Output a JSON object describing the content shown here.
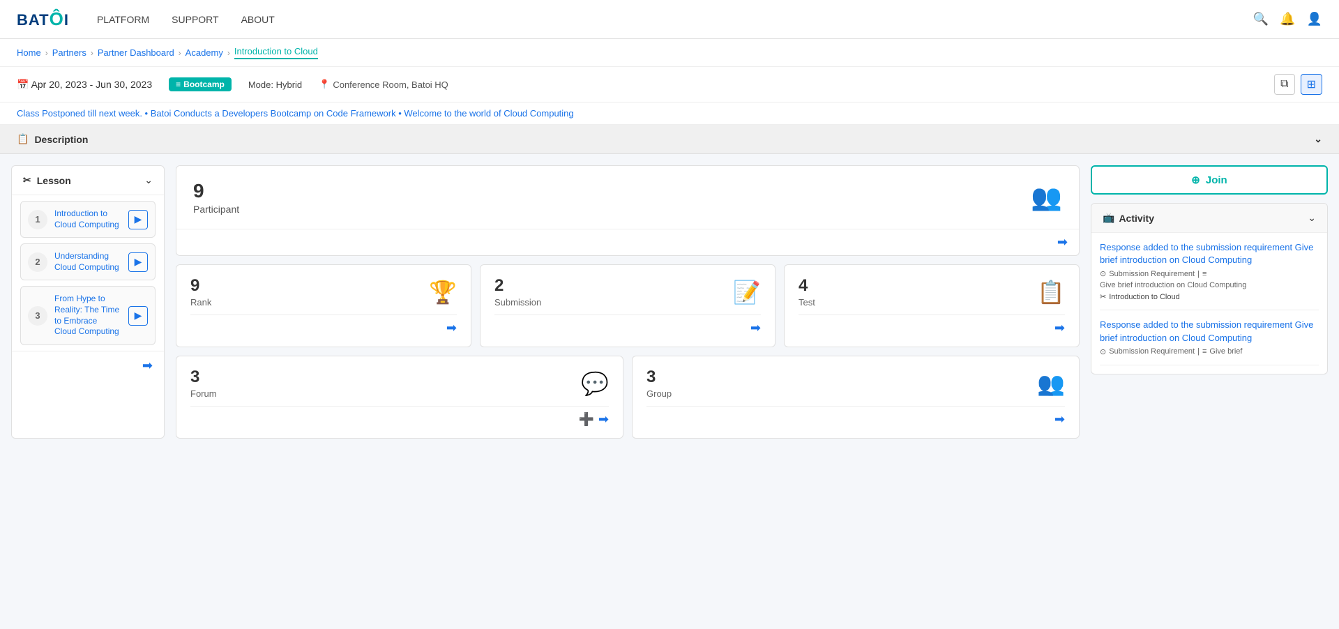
{
  "header": {
    "logo": "BATOI",
    "nav": [
      {
        "label": "PLATFORM",
        "id": "platform"
      },
      {
        "label": "SUPPORT",
        "id": "support"
      },
      {
        "label": "ABOUT",
        "id": "about"
      }
    ]
  },
  "breadcrumb": {
    "items": [
      "Home",
      "Partners",
      "Partner Dashboard",
      "Academy",
      "Introduction to Cloud"
    ]
  },
  "meta": {
    "date": "Apr 20, 2023  -  Jun 30, 2023",
    "badge": "Bootcamp",
    "mode": "Mode: Hybrid",
    "location": "Conference Room, Batoi HQ"
  },
  "ticker": "Class Postponed till next week.  •  Batoi Conducts a Developers Bootcamp on Code Framework  •  Welcome to the world of Cloud Computing",
  "description": {
    "label": "Description"
  },
  "lesson": {
    "title": "Lesson",
    "items": [
      {
        "num": 1,
        "title": "Introduction to Cloud Computing"
      },
      {
        "num": 2,
        "title": "Understanding Cloud Computing"
      },
      {
        "num": 3,
        "title": "From Hype to Reality: The Time to Embrace Cloud Computing"
      }
    ]
  },
  "participant": {
    "count": 9,
    "label": "Participant"
  },
  "stats": [
    {
      "num": 9,
      "label": "Rank"
    },
    {
      "num": 2,
      "label": "Submission"
    },
    {
      "num": 4,
      "label": "Test"
    }
  ],
  "bottom": [
    {
      "num": 3,
      "label": "Forum"
    },
    {
      "num": 3,
      "label": "Group"
    }
  ],
  "join_button": "Join",
  "activity": {
    "title": "Activity",
    "items": [
      {
        "title": "Response added to the submission requirement Give brief introduction on Cloud Computing",
        "meta1": "Submission Requirement",
        "meta2": "Give brief introduction on Cloud Computing",
        "course": "Introduction to Cloud"
      },
      {
        "title": "Response added to the submission requirement Give brief introduction on Cloud Computing",
        "meta1": "Submission Requirement",
        "meta2": "Give brief",
        "course": ""
      }
    ]
  }
}
